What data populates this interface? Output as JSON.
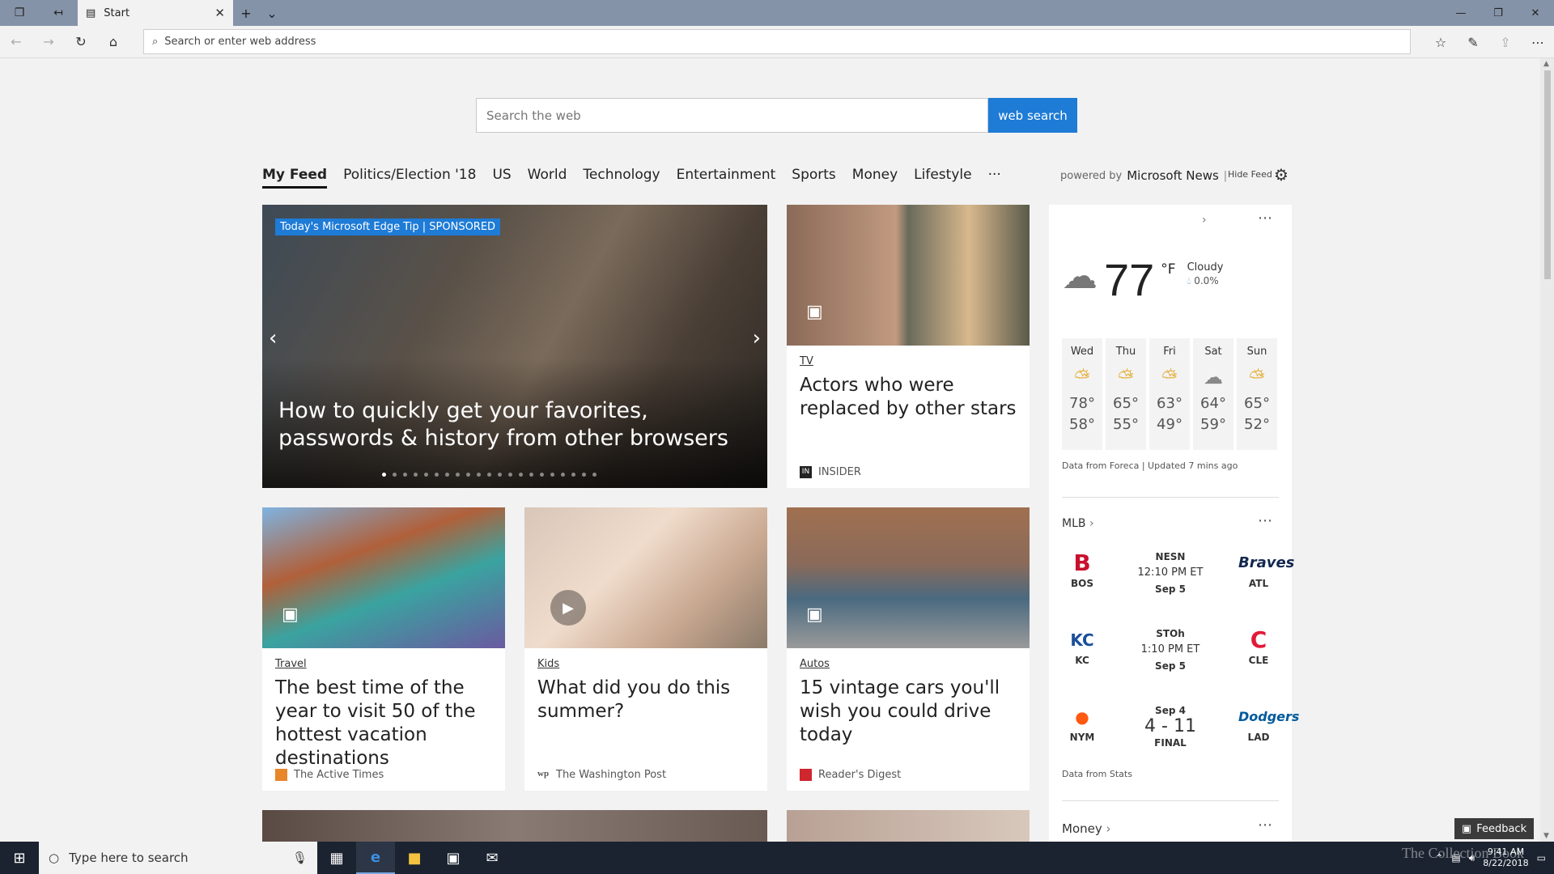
{
  "browser": {
    "tab_title": "Start",
    "address_placeholder": "Search or enter web address"
  },
  "search": {
    "placeholder": "Search the web",
    "button": "web search"
  },
  "feed_nav": {
    "items": [
      "My Feed",
      "Politics/Election '18",
      "US",
      "World",
      "Technology",
      "Entertainment",
      "Sports",
      "Money",
      "Lifestyle",
      "···"
    ],
    "powered_prefix": "powered by",
    "powered_brand": "Microsoft News",
    "separator": "|",
    "hide_feed": "Hide Feed"
  },
  "hero": {
    "badge": "Today's Microsoft Edge Tip | SPONSORED",
    "title": "How to quickly get your favorites, passwords & history from other browsers",
    "slide_count": 21,
    "current_slide": 1
  },
  "cards": [
    {
      "category": "TV",
      "headline": "Actors who were replaced by other stars",
      "source": "INSIDER",
      "source_logo": "IN"
    },
    {
      "category": "Travel",
      "headline": "The best time of the year to visit 50 of the hottest vacation destinations",
      "source": "The Active Times"
    },
    {
      "category": "Kids",
      "headline": "What did you do this summer?",
      "source": "The Washington Post",
      "source_logo": "wp"
    },
    {
      "category": "Autos",
      "headline": "15 vintage cars you'll wish you could drive today",
      "source": "Reader's Digest"
    }
  ],
  "weather": {
    "temp": "77",
    "unit": "°F",
    "condition": "Cloudy",
    "precip": "0.0%",
    "forecast": [
      {
        "day": "Wed",
        "hi": "78°",
        "lo": "58°"
      },
      {
        "day": "Thu",
        "hi": "65°",
        "lo": "55°"
      },
      {
        "day": "Fri",
        "hi": "63°",
        "lo": "49°"
      },
      {
        "day": "Sat",
        "hi": "64°",
        "lo": "59°"
      },
      {
        "day": "Sun",
        "hi": "65°",
        "lo": "52°"
      }
    ],
    "note": "Data from Foreca | Updated 7 mins ago"
  },
  "mlb": {
    "title": "MLB",
    "games": [
      {
        "away": "BOS",
        "home": "ATL",
        "channel": "NESN",
        "time": "12:10 PM ET",
        "date": "Sep 5"
      },
      {
        "away": "KC",
        "home": "CLE",
        "channel": "STOh",
        "time": "1:10 PM ET",
        "date": "Sep 5"
      },
      {
        "away": "NYM",
        "home": "LAD",
        "date": "Sep 4",
        "score": "4 - 11",
        "status": "FINAL"
      }
    ],
    "note": "Data from Stats"
  },
  "money_title": "Money",
  "feedback": "Feedback",
  "taskbar": {
    "search_placeholder": "Type here to search",
    "time": "9:41 AM",
    "date": "8/22/2018"
  },
  "watermark": "The Collection Book",
  "colors": {
    "accent": "#1e7bd6",
    "titlebar": "#8593a8",
    "taskbar": "#1b2330"
  }
}
